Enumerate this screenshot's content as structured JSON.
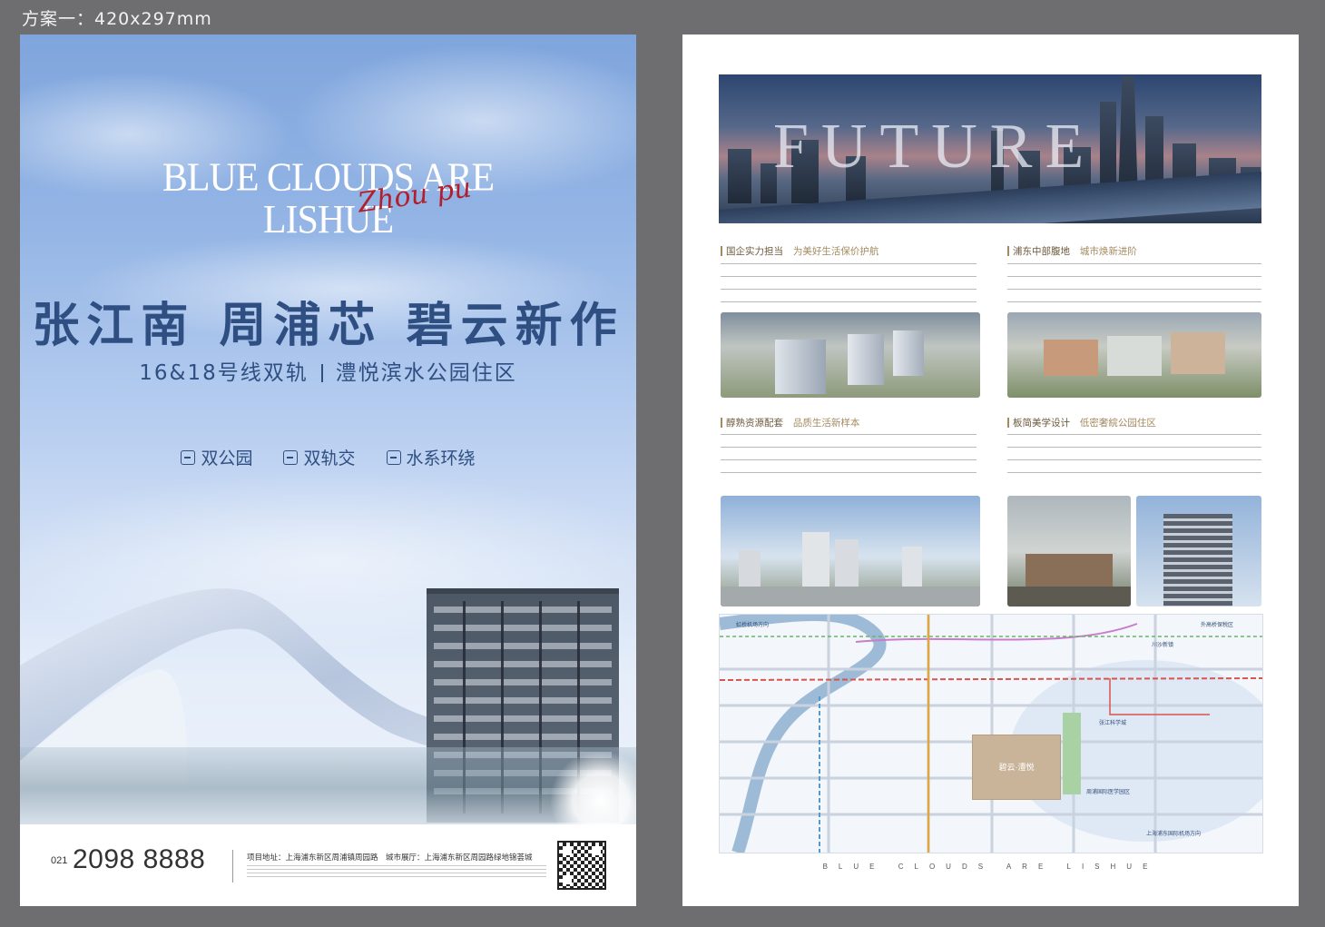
{
  "canvas": {
    "label": "方案一：420x297mm"
  },
  "left_poster": {
    "en_title_line1": "BLUE CLOUDS ARE",
    "en_title_line2": "LISHUE",
    "script_word": "Zhou pu",
    "cn_title": "张江南 周浦芯 碧云新作",
    "subtitle_left": "16&18号线双轨",
    "subtitle_right": "澧悦滨水公园住区",
    "features": [
      "双公园",
      "双轨交",
      "水系环绕"
    ],
    "tel_prefix": "021",
    "tel_number": "2098 8888",
    "address": "项目地址：上海浦东新区周浦镇周园路　城市展厅：上海浦东新区周园路绿地锦荟城"
  },
  "right_poster": {
    "banner_word": "FUTURE",
    "sections": [
      {
        "title": "国企实力担当",
        "accent": "为美好生活保价护航"
      },
      {
        "title": "浦东中部腹地",
        "accent": "城市焕新进阶"
      },
      {
        "title": "醇熟资源配套",
        "accent": "品质生活新样本"
      },
      {
        "title": "板简美学设计",
        "accent": "低密奢綄公园住区"
      }
    ],
    "map": {
      "center": "碧云·澧悦",
      "labels": [
        "张江科学城",
        "周浦国际医学园区",
        "上海浦东国际机场方向",
        "虹桥机场方向",
        "川沙新镇",
        "外高桥保税区"
      ]
    },
    "slogan": "BLUE CLOUDS ARE LISHUE"
  },
  "colors": {
    "navy": "#2f4e82",
    "gold": "#a48a60",
    "red_script": "#b31e2b"
  }
}
